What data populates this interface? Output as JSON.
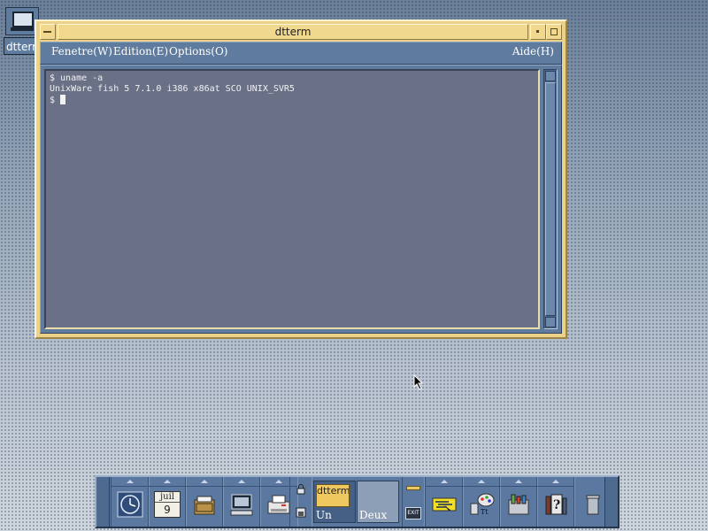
{
  "desktop_icon": {
    "label": "dtterm"
  },
  "window": {
    "title": "dtterm",
    "menus": [
      "Fenetre(W)",
      "Edition(E)",
      "Options(O)",
      "Aide(H)"
    ]
  },
  "terminal": {
    "lines": [
      "$ uname -a",
      "UnixWare fish 5 7.1.0 i386 x86at SCO UNIX_SVR5",
      "$ "
    ]
  },
  "front_panel": {
    "calendar": {
      "month": "juil",
      "day": "9"
    },
    "workspaces": [
      {
        "label": "Un",
        "active": true,
        "thumbnail_label": "dtterm"
      },
      {
        "label": "Deux",
        "active": false
      }
    ],
    "exit_label": "EXIT"
  },
  "colors": {
    "window_frame": "#ecd289",
    "menubar": "#5f7b9e",
    "terminal_bg": "#6a7085",
    "panel": "#5b78a0"
  }
}
